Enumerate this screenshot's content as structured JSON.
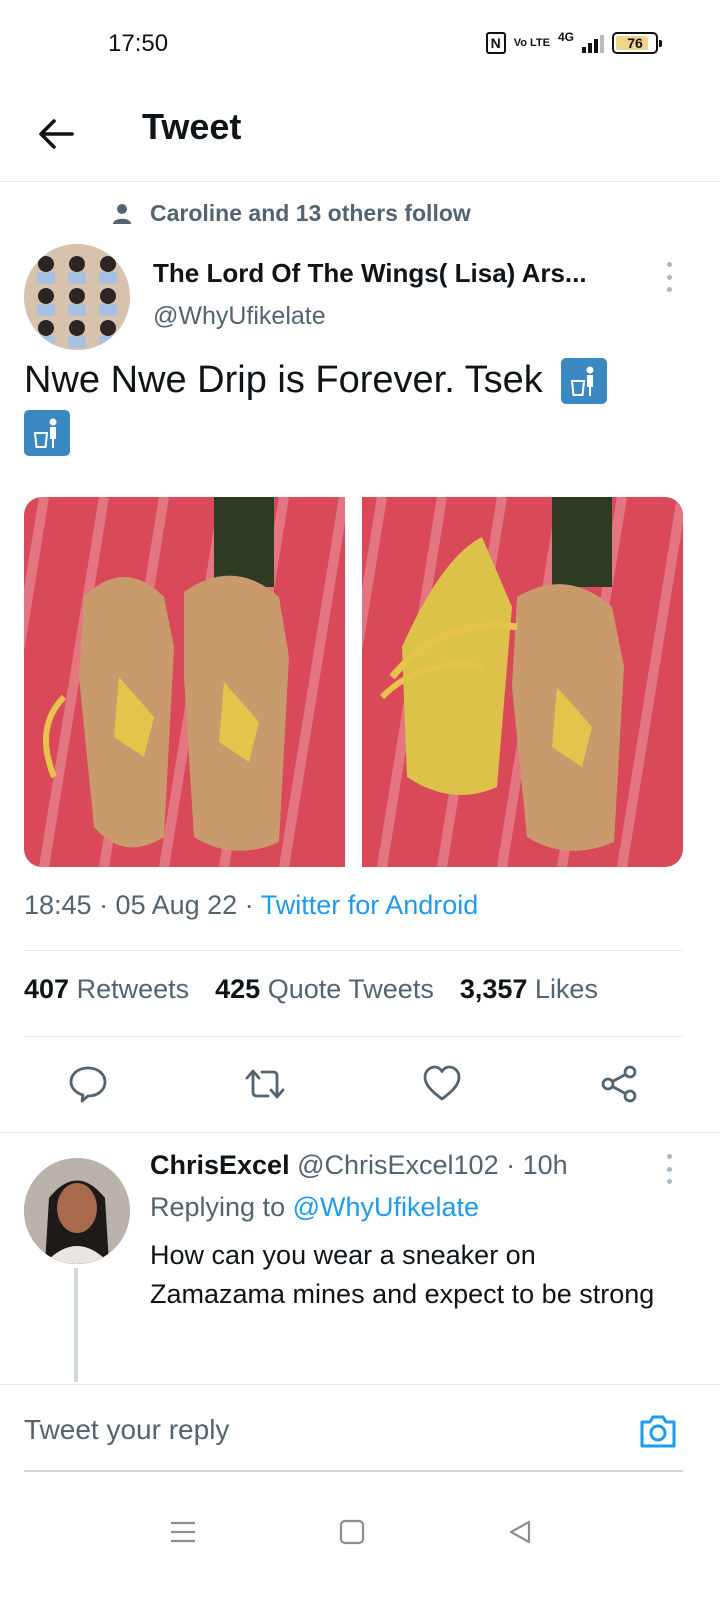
{
  "status_bar": {
    "time": "17:50",
    "network": "4G",
    "volte": "Vo LTE",
    "battery": "76"
  },
  "header": {
    "title": "Tweet"
  },
  "tweet": {
    "social_context": "Caroline and 13 others follow",
    "author_name": "The Lord Of The Wings( Lisa) Ars...",
    "author_handle": "@WhyUfikelate",
    "text": "Nwe Nwe Drip is Forever. Tsek",
    "timestamp": "18:45 · 05 Aug 22 · ",
    "source": "Twitter for Android",
    "stats": {
      "retweets_count": "407",
      "retweets_label": "Retweets",
      "quotes_count": "425",
      "quotes_label": "Quote Tweets",
      "likes_count": "3,357",
      "likes_label": "Likes"
    }
  },
  "reply": {
    "name": "ChrisExcel",
    "handle_time": "@ChrisExcel102 · 10h",
    "replying_label": "Replying to",
    "replying_to": "@WhyUfikelate",
    "text": "How can you wear a sneaker on Zamazama mines and expect to be strong"
  },
  "composer": {
    "placeholder": "Tweet your reply"
  },
  "colors": {
    "accent": "#1d9bf0",
    "secondary_text": "#536471",
    "primary_text": "#0f1419",
    "divider": "#e7e9ea"
  },
  "icons": {
    "back": "arrow-left-icon",
    "person": "person-icon",
    "more": "more-vertical-icon",
    "reply": "comment-icon",
    "retweet": "retweet-icon",
    "like": "heart-icon",
    "share": "share-icon",
    "camera": "camera-icon",
    "emoji": "put-litter-in-its-place-emoji"
  }
}
